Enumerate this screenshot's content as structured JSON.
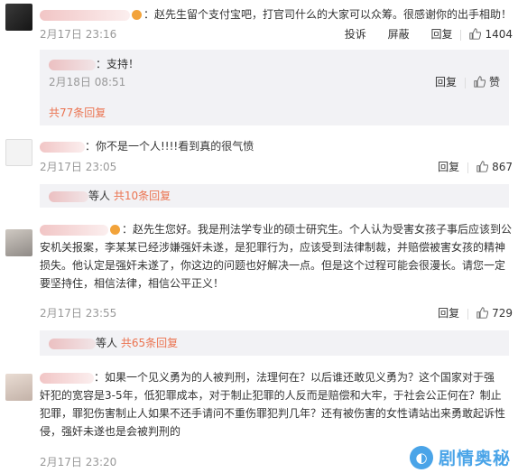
{
  "comments": [
    {
      "text": "：赵先生留个支付宝吧，打官司什么的大家可以众筹。很感谢你的出手相助！",
      "time": "2月17日 23:16",
      "actions": {
        "report": "投诉",
        "block": "屏蔽",
        "reply": "回复",
        "likes": "1404"
      },
      "replies": [
        {
          "text": "：支持！",
          "time": "2月18日 08:51",
          "reply": "回复",
          "like_label": "赞"
        }
      ],
      "more": "共77条回复"
    },
    {
      "text": "：你不是一个人!!!!看到真的很气愤",
      "time": "2月17日 23:05",
      "actions": {
        "reply": "回复",
        "likes": "867"
      },
      "more_suffix": "等人",
      "more": "共10条回复"
    },
    {
      "text_lines": [
        "：赵先生您好。我是刑法学专业的硕士研究生。个人认为受害女孩子事后应该到公",
        "安机关报案，李某某已经涉嫌强奸未遂，是犯罪行为，应该受到法律制裁，并赔偿被害女孩的精神",
        "损失。他认定是强奸未遂了，你这边的问题也好解决一点。但是这个过程可能会很漫长。请您一定",
        "要坚持住，相信法律，相信公平正义！"
      ],
      "time": "2月17日 23:55",
      "actions": {
        "reply": "回复",
        "likes": "729"
      },
      "more_suffix": "等人",
      "more": "共65条回复"
    },
    {
      "text_lines": [
        "：如果一个见义勇为的人被判刑，法理何在？以后谁还敢见义勇为？这个国家对于强",
        "奸犯的宽容是3-5年，低犯罪成本，对于制止犯罪的人反而是赔偿和大牢，于社会公正何在？制止",
        "犯罪，罪犯伤害制止人如果不还手请问不重伤罪犯判几年？还有被伤害的女性请站出来勇敢起诉性",
        "侵，强奸未遂也是会被判刑的"
      ],
      "time": "2月17日 23:20"
    }
  ],
  "watermark": {
    "glyph": "◐",
    "text": "剧情奥秘"
  },
  "colors": {
    "link": "#eb7350",
    "time": "#999999",
    "subbox_bg": "#f2f2f5",
    "watermark": "#4aa4e8"
  }
}
